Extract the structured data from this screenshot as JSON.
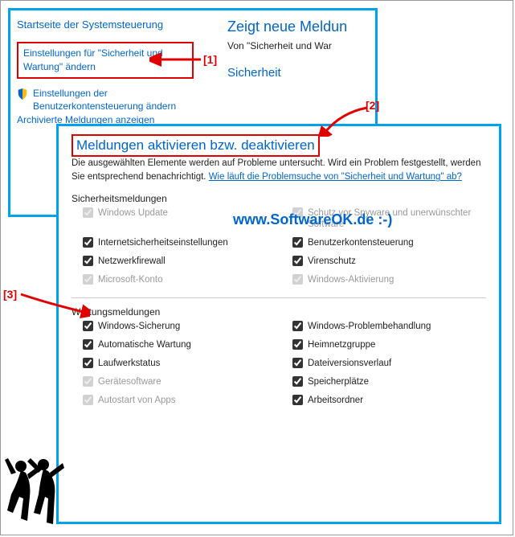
{
  "back": {
    "cp_home": "Startseite der Systemsteuerung",
    "link1": "Einstellungen für \"Sicherheit und Wartung\" ändern",
    "link2": "Einstellungen der Benutzerkontensteuerung ändern",
    "link3": "Archivierte Meldungen anzeigen",
    "title": "Zeigt neue Meldun",
    "subtitle": "Von \"Sicherheit und War",
    "section": "Sicherheit"
  },
  "front": {
    "title": "Meldungen aktivieren bzw. deaktivieren",
    "desc1": "Die ausgewählten Elemente werden auf Probleme untersucht. Wird ein Problem festgestellt, werden Sie entsprechend benachrichtigt. ",
    "desc_link": "Wie läuft die Problemsuche von \"Sicherheit und Wartung\" ab?",
    "sec1": "Sicherheitsmeldungen",
    "sec2": "Wartungsmeldungen",
    "security": [
      {
        "label": "Windows Update",
        "checked": true,
        "disabled": true
      },
      {
        "label": "Schutz vor Spyware und unerwünschter Software",
        "checked": true,
        "disabled": true
      },
      {
        "label": "Internetsicherheitseinstellungen",
        "checked": true,
        "disabled": false
      },
      {
        "label": "Benutzerkontensteuerung",
        "checked": true,
        "disabled": false
      },
      {
        "label": "Netzwerkfirewall",
        "checked": true,
        "disabled": false
      },
      {
        "label": "Virenschutz",
        "checked": true,
        "disabled": false
      },
      {
        "label": "Microsoft-Konto",
        "checked": true,
        "disabled": true
      },
      {
        "label": "Windows-Aktivierung",
        "checked": true,
        "disabled": true
      }
    ],
    "maintenance": [
      {
        "label": "Windows-Sicherung",
        "checked": true,
        "disabled": false
      },
      {
        "label": "Windows-Problembehandlung",
        "checked": true,
        "disabled": false
      },
      {
        "label": "Automatische Wartung",
        "checked": true,
        "disabled": false
      },
      {
        "label": "Heimnetzgruppe",
        "checked": true,
        "disabled": false
      },
      {
        "label": "Laufwerkstatus",
        "checked": true,
        "disabled": false
      },
      {
        "label": "Dateiversionsverlauf",
        "checked": true,
        "disabled": false
      },
      {
        "label": "Gerätesoftware",
        "checked": true,
        "disabled": true
      },
      {
        "label": "Speicherplätze",
        "checked": true,
        "disabled": false
      },
      {
        "label": "Autostart von Apps",
        "checked": true,
        "disabled": true
      },
      {
        "label": "Arbeitsordner",
        "checked": true,
        "disabled": false
      }
    ]
  },
  "callouts": {
    "c1": "[1]",
    "c2": "[2]",
    "c3": "[3]"
  },
  "watermark": "www.SoftwareOK.de :-)"
}
